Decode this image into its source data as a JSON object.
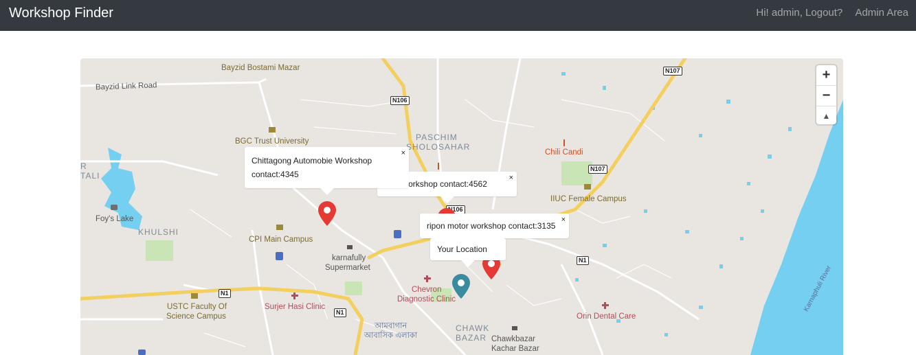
{
  "navbar": {
    "brand": "Workshop Finder",
    "greeting": "Hi! admin, Logout?",
    "admin_link": "Admin Area"
  },
  "map": {
    "controls": {
      "zoom_in": "+",
      "zoom_out": "−",
      "compass": "▲"
    },
    "labels": {
      "bayzid_mazar": "Bayzid Bostami Mazar",
      "bayzid_link": "Bayzid Link Road",
      "bgc": "BGC Trust University",
      "paschim1": "PASCHIM",
      "paschim2": "SHOLOSAHAR",
      "chili": "Chili Candi",
      "iiuc": "IIUC Female Campus",
      "foys": "Foy's Lake",
      "khulshi": "KHULSHI",
      "cpi": "CPI Main Campus",
      "karnafully1": "karnafully",
      "karnafully2": "Supermarket",
      "chevron1": "Chevron",
      "chevron2": "Diagnostic Clinic",
      "ustc1": "USTC Faculty Of",
      "ustc2": "Science Campus",
      "surjer": "Surjer Hasi Clinic",
      "bangla1": "আমবাগান",
      "bangla2": "আবাসিক এলাকা",
      "chawk1": "CHAWK",
      "chawk2": "BAZAR",
      "chawkbazar1": "Chawkbazar",
      "chawkbazar2": "Kachar Bazar",
      "orin": "Orin Dental Care",
      "river": "Karnaphuli River",
      "r_left": "R",
      "tali": "TALI"
    },
    "shields": {
      "n107a": "N107",
      "n106a": "N106",
      "n107b": "N107",
      "n106b": "N106",
      "n1a": "N1",
      "n1b": "N1",
      "n1c": "N1"
    },
    "popups": {
      "chittagong_line1": "Chittagong Automobie Workshop",
      "chittagong_line2": "contact:4345",
      "motor": "otor Workshop contact:4562",
      "ripon": "ripon motor workshop contact:3135",
      "your_location": "Your Location",
      "close": "×"
    },
    "colors": {
      "land": "#e9e6e1",
      "water": "#75cff0",
      "park": "#c9e4b5",
      "highway": "#f3cf60",
      "road": "#ffffff",
      "workshop_pin": "#e53935",
      "location_pin": "#3a8aa0"
    }
  }
}
